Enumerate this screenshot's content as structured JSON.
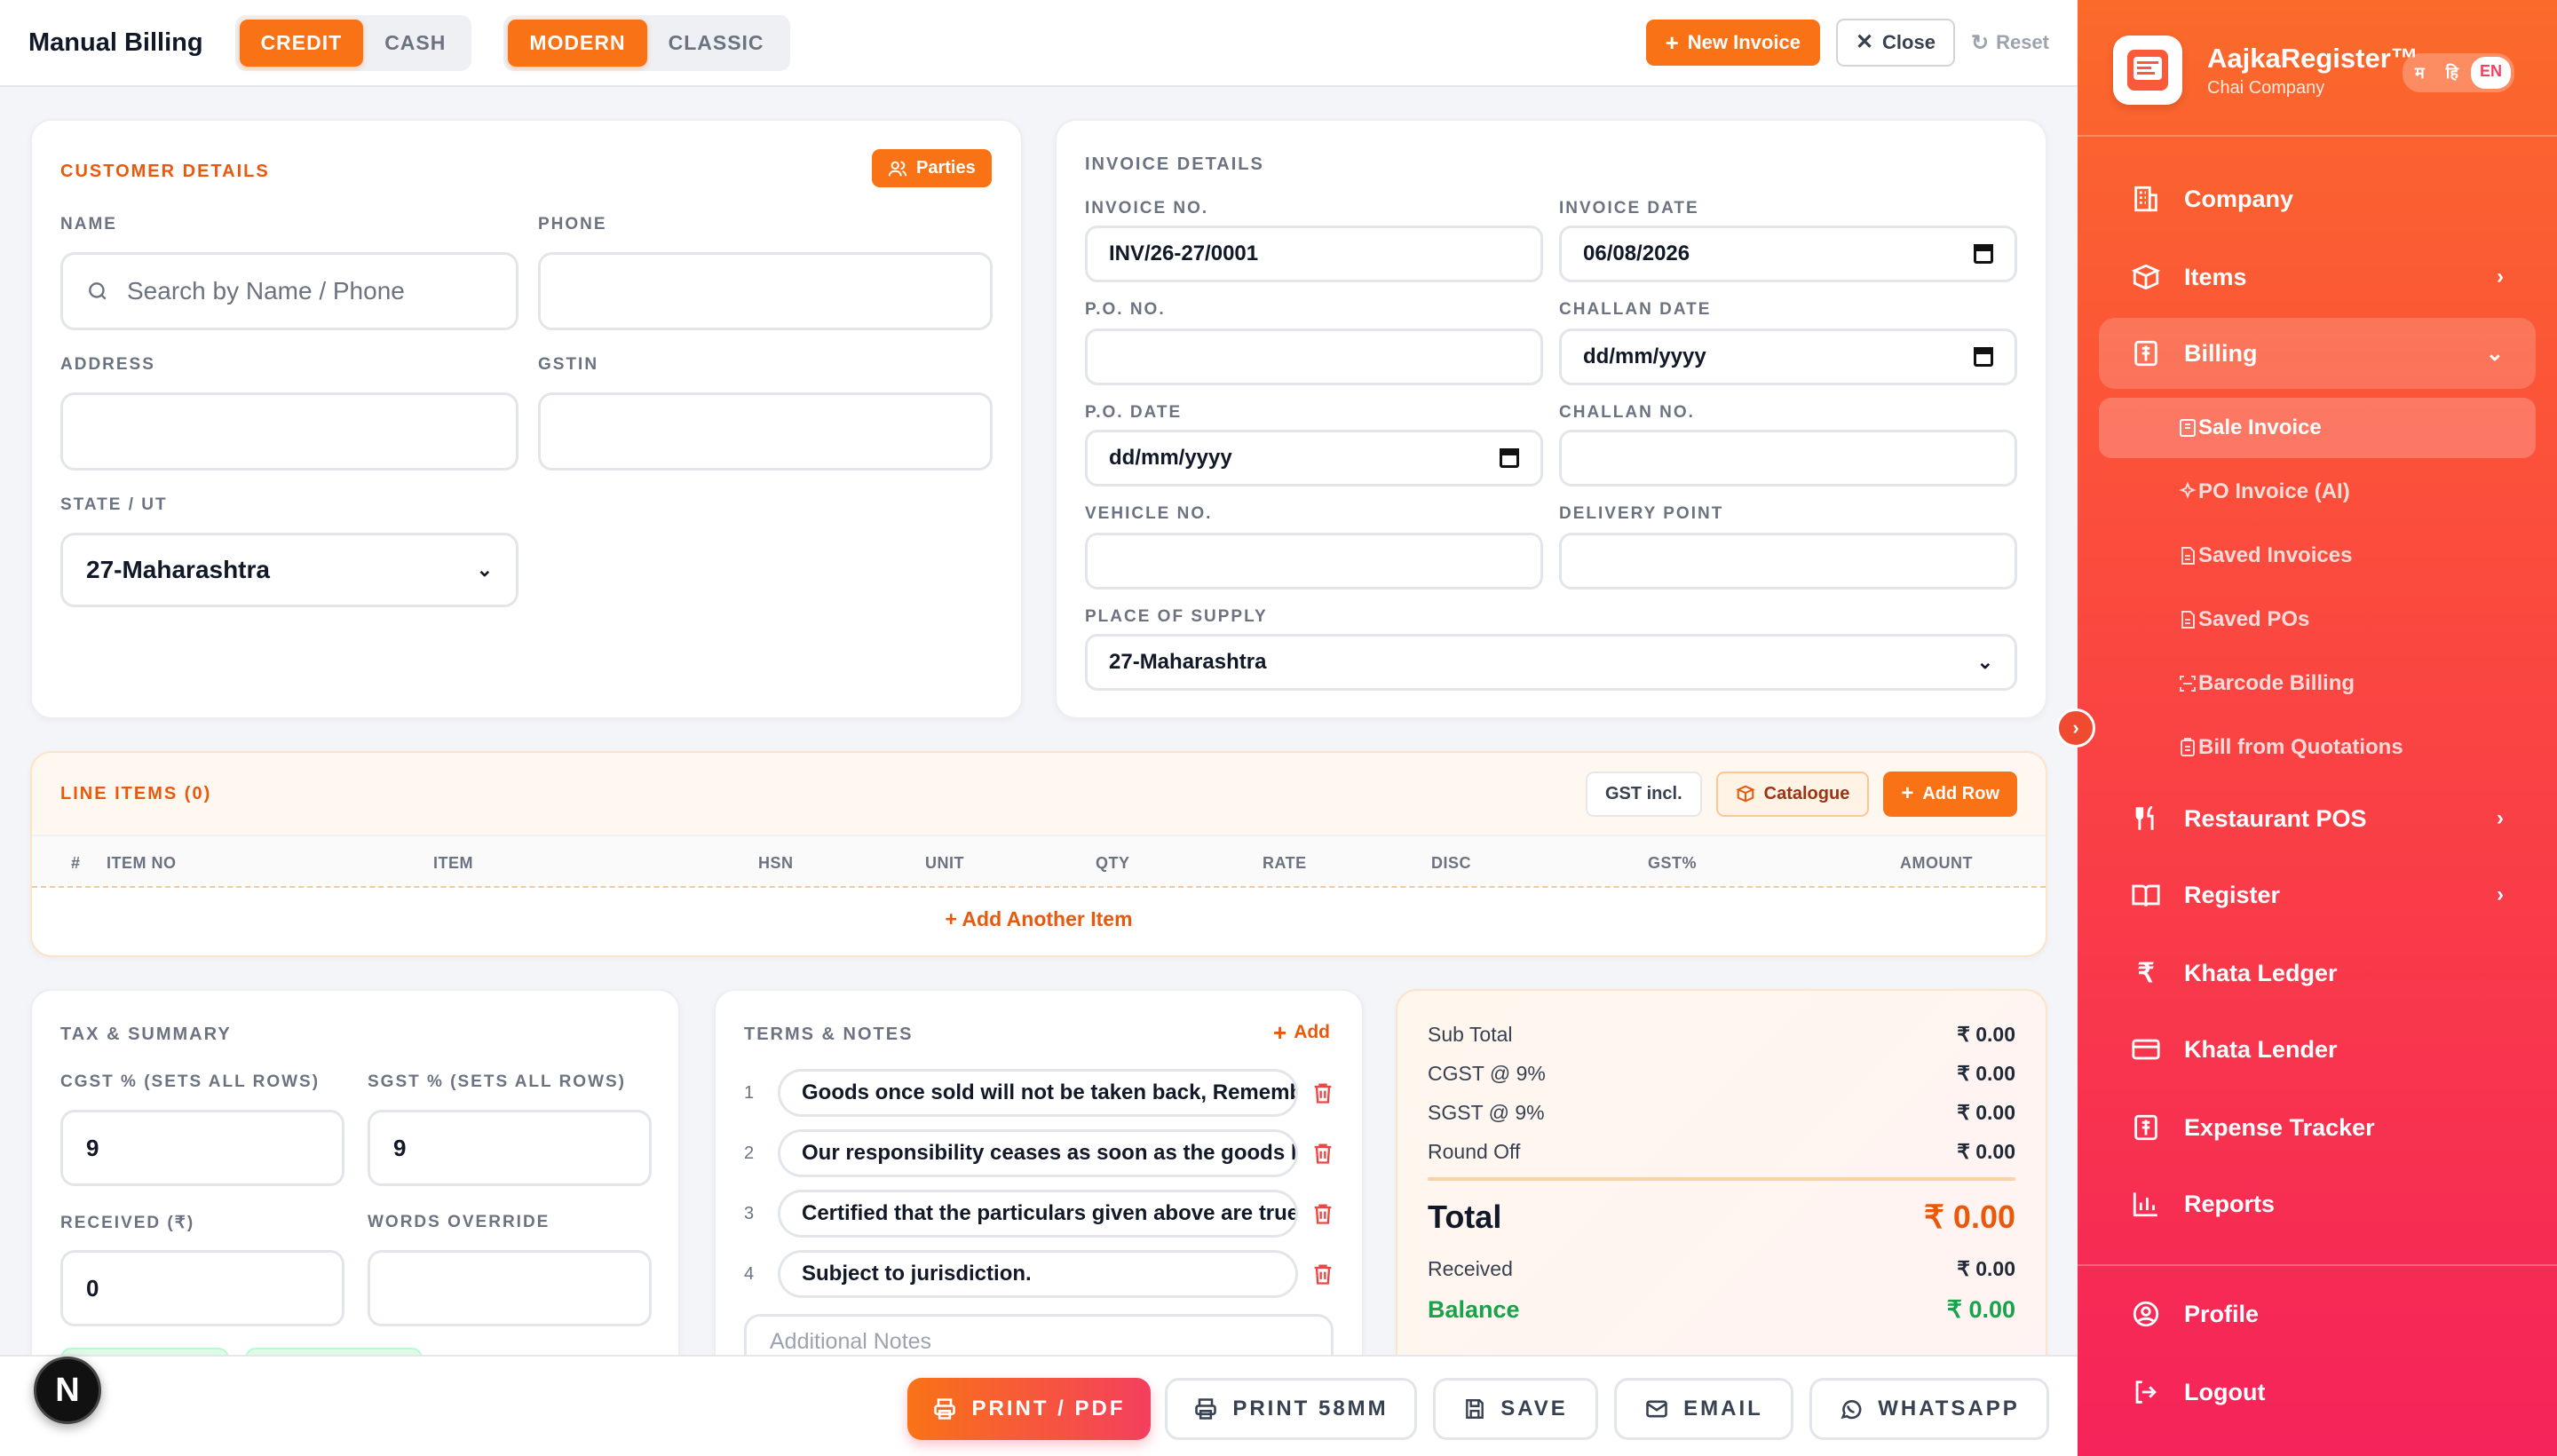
{
  "header": {
    "title": "Manual Billing",
    "payment_modes": [
      "CREDIT",
      "CASH"
    ],
    "payment_selected": "CREDIT",
    "templates": [
      "MODERN",
      "CLASSIC"
    ],
    "template_selected": "MODERN",
    "new_invoice": "New Invoice",
    "close": "Close",
    "reset": "Reset"
  },
  "customer": {
    "title": "CUSTOMER DETAILS",
    "parties_button": "Parties",
    "name_label": "NAME",
    "name_placeholder": "Search by Name / Phone",
    "phone_label": "PHONE",
    "phone_value": "",
    "address_label": "ADDRESS",
    "address_value": "",
    "gstin_label": "GSTIN",
    "gstin_value": "",
    "state_label": "STATE / UT",
    "state_value": "27-Maharashtra"
  },
  "invoice": {
    "title": "INVOICE DETAILS",
    "invoice_no_label": "INVOICE NO.",
    "invoice_no": "INV/26-27/0001",
    "invoice_date_label": "INVOICE DATE",
    "invoice_date": "06/08/2026",
    "po_no_label": "P.O. NO.",
    "po_no": "",
    "challan_date_label": "CHALLAN DATE",
    "challan_date": "dd/mm/yyyy",
    "po_date_label": "P.O. DATE",
    "po_date": "dd/mm/yyyy",
    "challan_no_label": "CHALLAN NO.",
    "challan_no": "",
    "vehicle_no_label": "VEHICLE NO.",
    "vehicle_no": "",
    "delivery_point_label": "DELIVERY POINT",
    "delivery_point": "",
    "place_of_supply_label": "PLACE OF SUPPLY",
    "place_of_supply": "27-Maharashtra"
  },
  "line_items": {
    "title": "LINE ITEMS (0)",
    "gst_toggle": "GST incl.",
    "catalogue": "Catalogue",
    "add_row": "Add Row",
    "columns": [
      "#",
      "ITEM NO",
      "ITEM",
      "HSN",
      "UNIT",
      "QTY",
      "RATE",
      "DISC",
      "GST%",
      "AMOUNT"
    ],
    "add_another": "+ Add Another Item"
  },
  "tax": {
    "title": "TAX & SUMMARY",
    "cgst_label": "CGST % (SETS ALL ROWS)",
    "cgst_value": "9",
    "sgst_label": "SGST % (SETS ALL ROWS)",
    "sgst_value": "9",
    "received_label": "RECEIVED (₹)",
    "received_value": "0",
    "words_label": "WORDS OVERRIDE",
    "words_value": ""
  },
  "terms": {
    "title": "TERMS & NOTES",
    "add": "Add",
    "items": [
      {
        "num": "1",
        "text": "Goods once sold will not be taken back, Remember"
      },
      {
        "num": "2",
        "text": "Our responsibility ceases as soon as the goods leave"
      },
      {
        "num": "3",
        "text": "Certified that the particulars given above are true"
      },
      {
        "num": "4",
        "text": "Subject to jurisdiction."
      }
    ],
    "notes_placeholder": "Additional Notes"
  },
  "summary": {
    "sub_total_label": "Sub Total",
    "sub_total": "₹ 0.00",
    "cgst_label": "CGST @ 9%",
    "cgst": "₹ 0.00",
    "sgst_label": "SGST @ 9%",
    "sgst": "₹ 0.00",
    "round_off_label": "Round Off",
    "round_off": "₹ 0.00",
    "total_label": "Total",
    "total": "₹ 0.00",
    "received_label": "Received",
    "received": "₹ 0.00",
    "balance_label": "Balance",
    "balance": "₹ 0.00"
  },
  "actions": {
    "print_pdf": "PRINT / PDF",
    "print_58": "PRINT 58MM",
    "save": "SAVE",
    "email": "EMAIL",
    "whatsapp": "WHATSAPP"
  },
  "sidebar": {
    "brand": "AajkaRegister™",
    "company": "Chai Company",
    "logo_text": "AajkaRegister",
    "languages": [
      "म",
      "हि",
      "EN"
    ],
    "language_selected": "EN",
    "items": [
      {
        "label": "Company"
      },
      {
        "label": "Items"
      },
      {
        "label": "Billing"
      },
      {
        "label": "Restaurant POS"
      },
      {
        "label": "Register"
      },
      {
        "label": "Khata Ledger"
      },
      {
        "label": "Khata Lender"
      },
      {
        "label": "Expense Tracker"
      },
      {
        "label": "Reports"
      }
    ],
    "billing_sub": [
      {
        "label": "Sale Invoice"
      },
      {
        "label": "PO Invoice (AI)"
      },
      {
        "label": "Saved Invoices"
      },
      {
        "label": "Saved POs"
      },
      {
        "label": "Barcode Billing"
      },
      {
        "label": "Bill from Quotations"
      }
    ],
    "profile": "Profile",
    "logout": "Logout"
  },
  "badge": "N",
  "colors": {
    "accent": "#f97316",
    "danger": "#ef4444",
    "balance": "#16a34a",
    "sidebar_top": "#fb6a2a",
    "sidebar_bottom": "#f5235a"
  }
}
